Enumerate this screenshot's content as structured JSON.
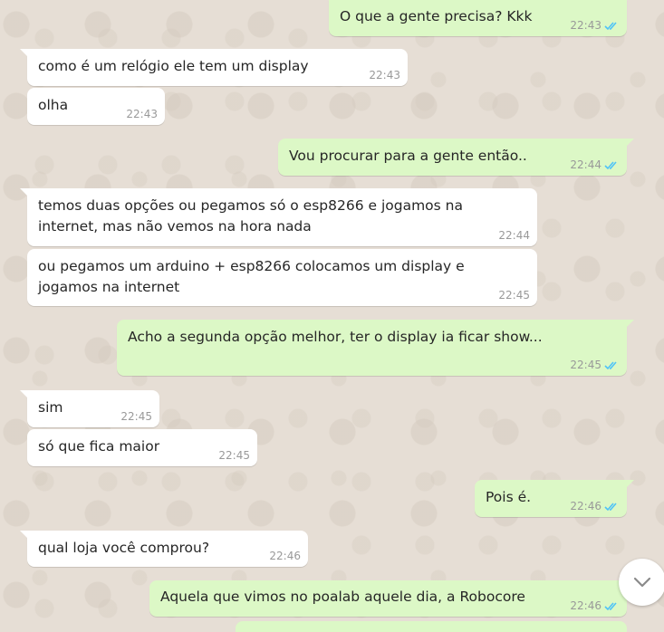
{
  "chat": {
    "messages": [
      {
        "id": "m1",
        "direction": "out",
        "text": "O que a gente precisa? Kkk",
        "time": "22:43",
        "status": "read"
      },
      {
        "id": "m2",
        "direction": "in",
        "text": "como é um relógio ele tem um display",
        "time": "22:43"
      },
      {
        "id": "m3",
        "direction": "in",
        "text": "olha",
        "time": "22:43"
      },
      {
        "id": "m4",
        "direction": "out",
        "text": "Vou procurar para a gente então..",
        "time": "22:44",
        "status": "read"
      },
      {
        "id": "m5",
        "direction": "in",
        "text": "temos duas opções ou pegamos só o esp8266 e jogamos na internet, mas não vemos na hora nada",
        "time": "22:44"
      },
      {
        "id": "m6",
        "direction": "in",
        "text": "ou pegamos um arduino + esp8266 colocamos um display e jogamos na internet",
        "time": "22:45"
      },
      {
        "id": "m7",
        "direction": "out",
        "text": "Acho a segunda opção melhor, ter o display ia ficar show...",
        "time": "22:45",
        "status": "read"
      },
      {
        "id": "m8",
        "direction": "in",
        "text": "sim",
        "time": "22:45"
      },
      {
        "id": "m9",
        "direction": "in",
        "text": "só que fica maior",
        "time": "22:45"
      },
      {
        "id": "m10",
        "direction": "out",
        "text": "Pois é.",
        "time": "22:46",
        "status": "read"
      },
      {
        "id": "m11",
        "direction": "in",
        "text": "qual loja você comprou?",
        "time": "22:46"
      },
      {
        "id": "m12",
        "direction": "out",
        "text": "Aquela que vimos no poalab aquele dia, a Robocore",
        "time": "22:46",
        "status": "read"
      }
    ]
  },
  "colors": {
    "incoming_bubble": "#ffffff",
    "outgoing_bubble": "#dcf8c6",
    "read_ticks": "#4fc3f7",
    "timestamp": "#999999",
    "background": "#e6ded5"
  },
  "icons": {
    "read_receipt": "double-check-icon",
    "scroll_down": "chevron-down-icon"
  }
}
